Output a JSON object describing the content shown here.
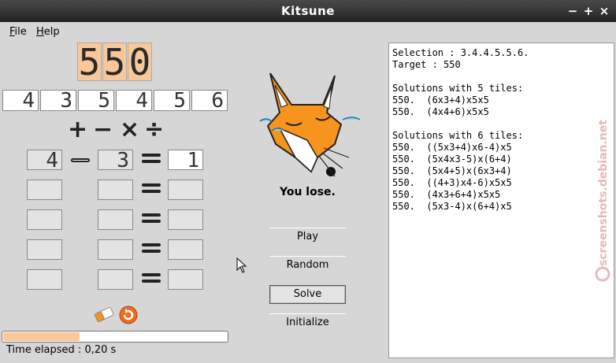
{
  "window": {
    "title": "Kitsune",
    "buttons": [
      "−",
      "+",
      "×"
    ]
  },
  "menu": [
    {
      "label": "File",
      "accel": "F",
      "rest": "ile"
    },
    {
      "label": "Help",
      "accel": "H",
      "rest": "elp"
    }
  ],
  "target_digits": [
    "5",
    "5",
    "0"
  ],
  "tiles": [
    "4",
    "3",
    "5",
    "4",
    "5",
    "6"
  ],
  "operators": [
    "+",
    "−",
    "×",
    "÷"
  ],
  "equations": [
    {
      "a": "4",
      "op": "−",
      "b": "3",
      "result": "1"
    },
    {
      "a": "",
      "op": "",
      "b": "",
      "result": ""
    },
    {
      "a": "",
      "op": "",
      "b": "",
      "result": ""
    },
    {
      "a": "",
      "op": "",
      "b": "",
      "result": ""
    },
    {
      "a": "",
      "op": "",
      "b": "",
      "result": ""
    }
  ],
  "status_message": "You lose.",
  "buttons": {
    "play": "Play",
    "random": "Random",
    "solve": "Solve",
    "initialize": "Initialize"
  },
  "progress": {
    "fraction": 0.34
  },
  "time_elapsed": "Time elapsed : 0,20 s",
  "output_lines": [
    "Selection : 3.4.4.5.5.6.",
    "Target : 550",
    "",
    "Solutions with 5 tiles:",
    "550.  (6x3+4)x5x5",
    "550.  (4x4+6)x5x5",
    "",
    "Solutions with 6 tiles:",
    "550.  ((5x3+4)x6-4)x5",
    "550.  (5x4x3-5)x(6+4)",
    "550.  (5x4+5)x(6x3+4)",
    "550.  ((4+3)x4-6)x5x5",
    "550.  (4x3+6+4)x5x5",
    "550.  (5x3-4)x(6+4)x5"
  ],
  "watermark": "screenshots.debian.net",
  "colors": {
    "accent": "#f8c89a",
    "titlebar": "#2e2e2e",
    "fox": "#f7941d"
  }
}
